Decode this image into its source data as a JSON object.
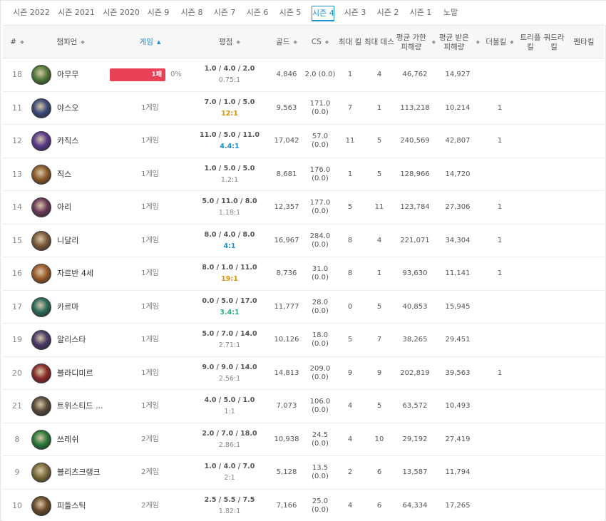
{
  "seasons": [
    {
      "label": "시즌 2022",
      "active": false
    },
    {
      "label": "시즌 2021",
      "active": false
    },
    {
      "label": "시즌 2020",
      "active": false
    },
    {
      "label": "시즌 9",
      "active": false
    },
    {
      "label": "시즌 8",
      "active": false
    },
    {
      "label": "시즌 7",
      "active": false
    },
    {
      "label": "시즌 6",
      "active": false
    },
    {
      "label": "시즌 5",
      "active": false
    },
    {
      "label": "시즌 4",
      "active": true
    },
    {
      "label": "시즌 3",
      "active": false
    },
    {
      "label": "시즌 2",
      "active": false
    },
    {
      "label": "시즌 1",
      "active": false
    },
    {
      "label": "노말",
      "active": false
    }
  ],
  "columns": {
    "rank": "#",
    "champion": "챔피언",
    "games": "게임",
    "kda": "평점",
    "gold": "골드",
    "cs": "CS",
    "max_kills": "최대 킬",
    "max_deaths": "최대 데스",
    "avg_dealt": "평균 가한 피해량",
    "avg_taken": "평균 받은 피해량",
    "double": "더블킬",
    "triple": "트리플 킬",
    "quadra": "쿼드라 킬",
    "penta": "펜타킬"
  },
  "accent_color": "#1f8ecd",
  "loss_color": "#e84057",
  "rows": [
    {
      "rank": "18",
      "champion": "아무무",
      "avatar_color": "#4f7a3a",
      "games": "",
      "loss_label": "1패",
      "winrate": "0%",
      "kda": "1.0 / 4.0 / 2.0",
      "ratio": "0.75:1",
      "ratio_style": "gray",
      "gold": "4,846",
      "cs": "2.0 (0.0)",
      "max_kills": "1",
      "max_deaths": "4",
      "avg_dealt": "46,762",
      "avg_taken": "14,927",
      "double": ""
    },
    {
      "rank": "11",
      "champion": "야스오",
      "avatar_color": "#3b4a7a",
      "games": "1게임",
      "kda": "7.0 / 1.0 / 5.0",
      "ratio": "12:1",
      "ratio_style": "orange",
      "gold": "9,563",
      "cs": "171.0\n(0.0)",
      "max_kills": "7",
      "max_deaths": "1",
      "avg_dealt": "113,218",
      "avg_taken": "10,214",
      "double": "1"
    },
    {
      "rank": "12",
      "champion": "카직스",
      "avatar_color": "#5a3a8a",
      "games": "1게임",
      "kda": "11.0 / 5.0 / 11.0",
      "ratio": "4.4:1",
      "ratio_style": "blue",
      "gold": "17,042",
      "cs": "57.0\n(0.0)",
      "max_kills": "11",
      "max_deaths": "5",
      "avg_dealt": "240,569",
      "avg_taken": "42,807",
      "double": "1"
    },
    {
      "rank": "13",
      "champion": "직스",
      "avatar_color": "#8a5a2a",
      "games": "1게임",
      "kda": "1.0 / 5.0 / 5.0",
      "ratio": "1.2:1",
      "ratio_style": "gray",
      "gold": "8,681",
      "cs": "176.0\n(0.0)",
      "max_kills": "1",
      "max_deaths": "5",
      "avg_dealt": "128,966",
      "avg_taken": "14,720",
      "double": ""
    },
    {
      "rank": "14",
      "champion": "아리",
      "avatar_color": "#6a3a5a",
      "games": "1게임",
      "kda": "5.0 / 11.0 / 8.0",
      "ratio": "1.18:1",
      "ratio_style": "gray",
      "gold": "12,357",
      "cs": "177.0\n(0.0)",
      "max_kills": "5",
      "max_deaths": "11",
      "avg_dealt": "123,784",
      "avg_taken": "27,306",
      "double": "1"
    },
    {
      "rank": "15",
      "champion": "니달리",
      "avatar_color": "#7a5a3a",
      "games": "1게임",
      "kda": "8.0 / 4.0 / 8.0",
      "ratio": "4:1",
      "ratio_style": "blue",
      "gold": "16,967",
      "cs": "284.0\n(0.0)",
      "max_kills": "8",
      "max_deaths": "4",
      "avg_dealt": "221,071",
      "avg_taken": "34,304",
      "double": "1"
    },
    {
      "rank": "16",
      "champion": "자르반 4세",
      "avatar_color": "#9a5a2a",
      "games": "1게임",
      "kda": "8.0 / 1.0 / 11.0",
      "ratio": "19:1",
      "ratio_style": "orange",
      "gold": "8,736",
      "cs": "31.0\n(0.0)",
      "max_kills": "8",
      "max_deaths": "1",
      "avg_dealt": "93,630",
      "avg_taken": "11,141",
      "double": "1"
    },
    {
      "rank": "17",
      "champion": "카르마",
      "avatar_color": "#2a6a5a",
      "games": "1게임",
      "kda": "0.0 / 5.0 / 17.0",
      "ratio": "3.4:1",
      "ratio_style": "green",
      "gold": "11,777",
      "cs": "28.0\n(0.0)",
      "max_kills": "0",
      "max_deaths": "5",
      "avg_dealt": "40,853",
      "avg_taken": "15,945",
      "double": ""
    },
    {
      "rank": "19",
      "champion": "알리스타",
      "avatar_color": "#4a3a6a",
      "games": "1게임",
      "kda": "5.0 / 7.0 / 14.0",
      "ratio": "2.71:1",
      "ratio_style": "gray",
      "gold": "10,126",
      "cs": "18.0\n(0.0)",
      "max_kills": "5",
      "max_deaths": "7",
      "avg_dealt": "38,265",
      "avg_taken": "29,451",
      "double": ""
    },
    {
      "rank": "20",
      "champion": "블라디미르",
      "avatar_color": "#8a2a2a",
      "games": "1게임",
      "kda": "9.0 / 9.0 / 14.0",
      "ratio": "2.56:1",
      "ratio_style": "gray",
      "gold": "14,813",
      "cs": "209.0\n(0.0)",
      "max_kills": "9",
      "max_deaths": "9",
      "avg_dealt": "202,819",
      "avg_taken": "39,563",
      "double": "1"
    },
    {
      "rank": "21",
      "champion": "트위스티드 ...",
      "avatar_color": "#5a4a3a",
      "games": "1게임",
      "kda": "4.0 / 5.0 / 1.0",
      "ratio": "1:1",
      "ratio_style": "gray",
      "gold": "7,073",
      "cs": "106.0\n(0.0)",
      "max_kills": "4",
      "max_deaths": "5",
      "avg_dealt": "63,572",
      "avg_taken": "10,493",
      "double": ""
    },
    {
      "rank": "8",
      "champion": "쓰레쉬",
      "avatar_color": "#2a7a3a",
      "games": "2게임",
      "kda": "2.0 / 7.0 / 18.0",
      "ratio": "2.86:1",
      "ratio_style": "gray",
      "gold": "10,938",
      "cs": "24.5\n(0.0)",
      "max_kills": "4",
      "max_deaths": "10",
      "avg_dealt": "29,192",
      "avg_taken": "27,419",
      "double": ""
    },
    {
      "rank": "9",
      "champion": "블리츠크랭크",
      "avatar_color": "#7a6a3a",
      "games": "2게임",
      "kda": "1.0 / 4.0 / 7.0",
      "ratio": "2:1",
      "ratio_style": "gray",
      "gold": "5,128",
      "cs": "13.5\n(0.0)",
      "max_kills": "2",
      "max_deaths": "6",
      "avg_dealt": "13,587",
      "avg_taken": "11,794",
      "double": ""
    },
    {
      "rank": "10",
      "champion": "피들스틱",
      "avatar_color": "#6a4a2a",
      "games": "2게임",
      "kda": "2.5 / 5.5 / 7.5",
      "ratio": "1.82:1",
      "ratio_style": "gray",
      "gold": "7,166",
      "cs": "25.0\n(0.0)",
      "max_kills": "4",
      "max_deaths": "6",
      "avg_dealt": "64,334",
      "avg_taken": "17,265",
      "double": ""
    }
  ]
}
